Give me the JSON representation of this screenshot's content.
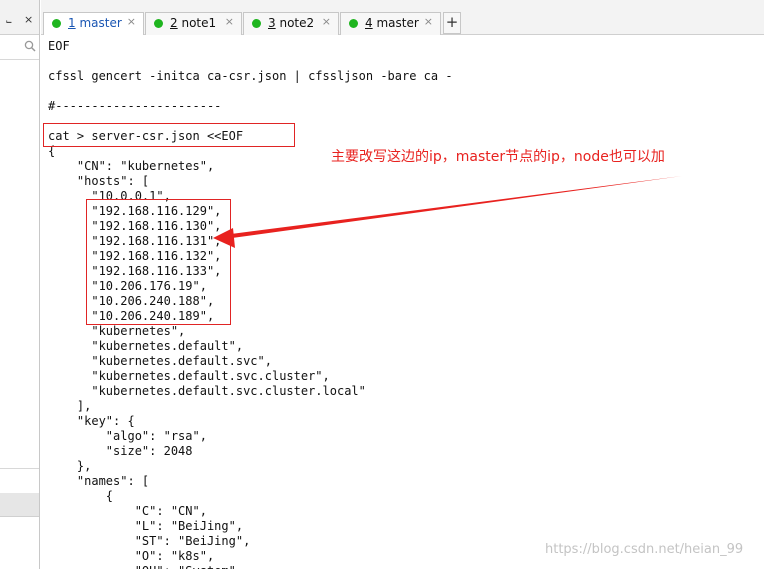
{
  "tabs": [
    {
      "num": "1",
      "name": "master",
      "dot_color": "#1fb51f",
      "active": true
    },
    {
      "num": "2",
      "name": "note1",
      "dot_color": "#1fb51f",
      "active": false
    },
    {
      "num": "3",
      "name": "note2",
      "dot_color": "#1fb51f",
      "active": false
    },
    {
      "num": "4",
      "name": "master",
      "dot_color": "#1fb51f",
      "active": false
    }
  ],
  "tab_close_glyph": "×",
  "new_tab_glyph": "+",
  "editor_lines": [
    "EOF",
    "",
    "cfssl gencert -initca ca-csr.json | cfssljson -bare ca -",
    "",
    "#-----------------------",
    "",
    "cat > server-csr.json <<EOF",
    "{",
    "    \"CN\": \"kubernetes\",",
    "    \"hosts\": [",
    "      \"10.0.0.1\",",
    "      \"192.168.116.129\",",
    "      \"192.168.116.130\",",
    "      \"192.168.116.131\",",
    "      \"192.168.116.132\",",
    "      \"192.168.116.133\",",
    "      \"10.206.176.19\",",
    "      \"10.206.240.188\",",
    "      \"10.206.240.189\",",
    "      \"kubernetes\",",
    "      \"kubernetes.default\",",
    "      \"kubernetes.default.svc\",",
    "      \"kubernetes.default.svc.cluster\",",
    "      \"kubernetes.default.svc.cluster.local\"",
    "    ],",
    "    \"key\": {",
    "        \"algo\": \"rsa\",",
    "        \"size\": 2048",
    "    },",
    "    \"names\": [",
    "        {",
    "            \"C\": \"CN\",",
    "            \"L\": \"BeiJing\",",
    "            \"ST\": \"BeiJing\",",
    "            \"O\": \"k8s\",",
    "            \"OU\": \"System\""
  ],
  "annotation": {
    "text": "主要改写这边的ip，master节点的ip，node也可以加",
    "color": "#e8221f"
  },
  "watermark": "https://blog.csdn.net/heian_99",
  "icons": {
    "pin": "pin-icon",
    "close": "close-icon",
    "search": "search-icon"
  }
}
